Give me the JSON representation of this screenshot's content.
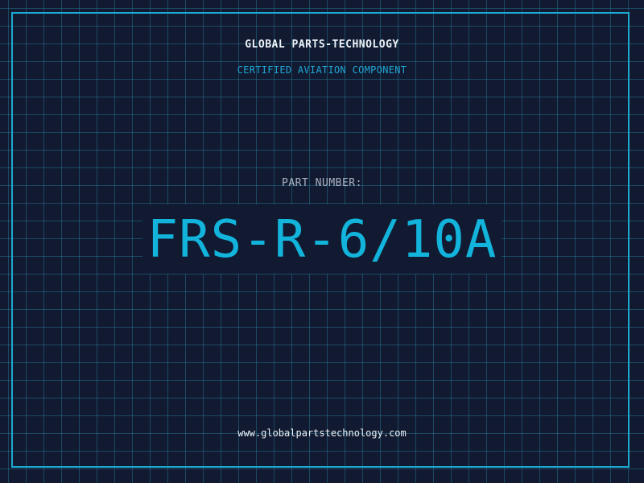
{
  "header": {
    "company_name": "GLOBAL PARTS-TECHNOLOGY",
    "subtitle": "CERTIFIED AVIATION COMPONENT"
  },
  "part": {
    "label": "PART NUMBER:",
    "number": "FRS-R-6/10A"
  },
  "footer": {
    "website": "www.globalpartstechnology.com"
  },
  "colors": {
    "background": "#111a30",
    "grid": "#28829f",
    "frame": "#1ca8d0",
    "accent": "#12b4dc",
    "text_primary": "#eef3f8",
    "text_muted": "#aab4c4"
  }
}
